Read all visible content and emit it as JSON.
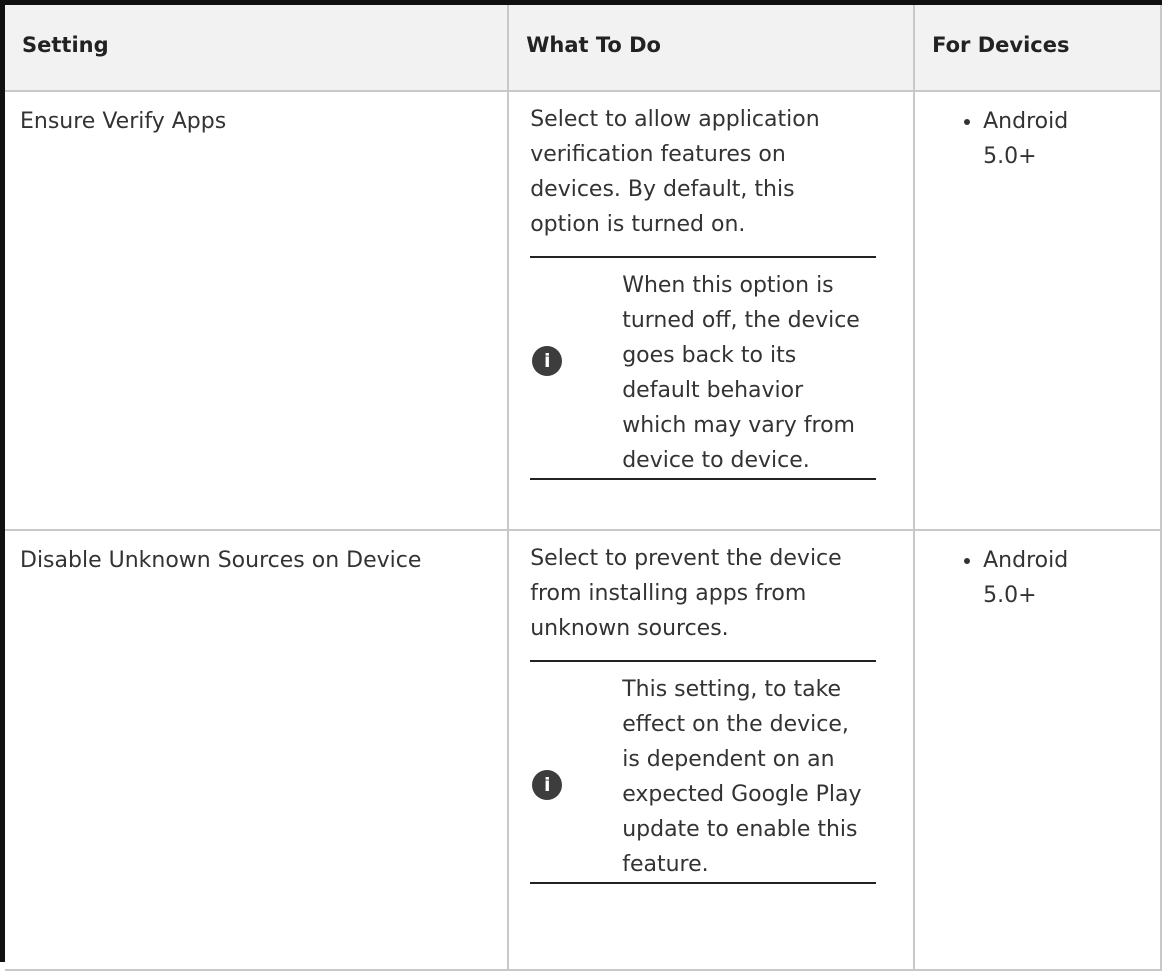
{
  "table": {
    "headers": {
      "setting": "Setting",
      "what_to_do": "What To Do",
      "for_devices": "For Devices"
    },
    "rows": [
      {
        "setting": "Ensure Verify Apps",
        "what_to_do": "Select to allow application verification features on devices. By default, this option is turned on.",
        "note": "When this option is turned off, the device goes back to its default behavior which may vary from device to device.",
        "note_icon": "info-icon",
        "devices": [
          "Android 5.0+"
        ]
      },
      {
        "setting": "Disable Unknown Sources on Device",
        "what_to_do": "Select to prevent the device from installing apps from unknown sources.",
        "note": "This setting, to take effect on the device, is dependent on an expected Google Play update to enable this feature.",
        "note_icon": "info-icon",
        "devices": [
          "Android 5.0+"
        ]
      }
    ]
  },
  "colors": {
    "header_background": "#f2f2f2",
    "grid_line": "#c8c8c8",
    "icon_fill": "#3d3d3d"
  }
}
